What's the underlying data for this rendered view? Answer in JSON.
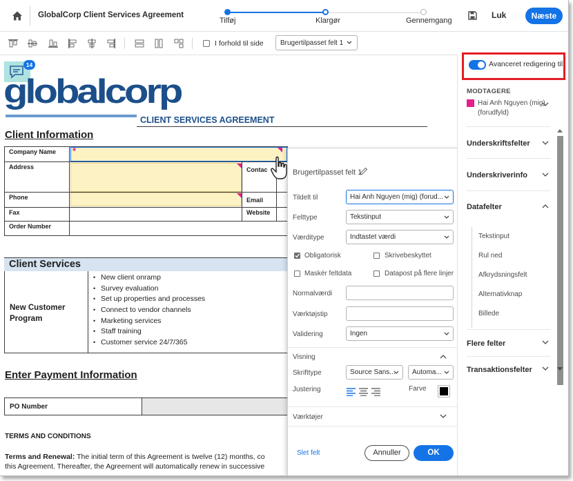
{
  "header": {
    "doc_title": "GlobalCorp Client Services Agreement",
    "steps": [
      "Tilføj",
      "Klargør",
      "Gennemgang"
    ],
    "close_label": "Luk",
    "next_label": "Næste"
  },
  "toolbar": {
    "proportional_label": "I forhold til side",
    "field_select": "Brugertilpasset felt 1"
  },
  "document": {
    "comment_count": "14",
    "logo_text": "globalcorp",
    "logo_sub": "CLIENT SERVICES AGREEMENT",
    "client_info_heading": "Client Information",
    "client_info_rows": {
      "company_name": "Company Name",
      "address": "Address",
      "contact": "Contac",
      "phone": "Phone",
      "email": "Email",
      "fax": "Fax",
      "website": "Website",
      "order_number": "Order Number"
    },
    "required_mark": "*",
    "client_services_heading": "Client Services",
    "program_label": "New Customer Program",
    "services": [
      "New client onramp",
      "Survey evaluation",
      "Set up properties and processes",
      "Connect to vendor channels",
      "Marketing services",
      "Staff training",
      "Customer service 24/7/365"
    ],
    "payment_heading": "Enter Payment Information",
    "po_label": "PO Number",
    "terms_heading": "TERMS AND CONDITIONS",
    "terms_bold": "Terms and Renewal:",
    "terms_line1": " The initial term of this Agreement is twelve (12) months, co",
    "terms_line2": "this Agreement. Thereafter, the Agreement will automatically renew in successive"
  },
  "popup": {
    "title": "Brugertilpasset felt 1",
    "assigned_label": "Tildelt til",
    "assigned_value": "Hai Anh Nguyen (mig) (forud...",
    "field_type_label": "Felttype",
    "field_type_value": "Tekstinput",
    "value_type_label": "Værditype",
    "value_type_value": "Indtastet værdi",
    "required_label": "Obligatorisk",
    "readonly_label": "Skrivebeskyttet",
    "mask_label": "Maskér feltdata",
    "multiline_label": "Datapost på flere linjer",
    "default_label": "Normalværdi",
    "tooltip_label": "Værktøjstip",
    "validation_label": "Validering",
    "validation_value": "Ingen",
    "display_label": "Visning",
    "font_label": "Skrifttype",
    "font_value": "Source Sans...",
    "size_value": "Automa...",
    "align_label": "Justering",
    "color_label": "Farve",
    "tools_label": "Værktøjer",
    "delete_link": "Slet felt",
    "cancel_label": "Annuller",
    "ok_label": "OK"
  },
  "rpanel": {
    "advanced_toggle": "Avanceret redigering til",
    "recipients_caps": "MODTAGERE",
    "recipient_name": "Hai Anh Nguyen (mig) (forudfyld)",
    "sections": [
      "Underskriftsfelter",
      "Underskriverinfo",
      "Datafelter"
    ],
    "data_fields": [
      "Tekstinput",
      "Rul ned",
      "Afkrydsningsfelt",
      "Alternativknap",
      "Billede"
    ],
    "more_fields": "Flere felter",
    "transaction_fields": "Transaktionsfelter"
  },
  "colors": {
    "accent": "#1473e6",
    "recipient": "#e61d8c",
    "highlight_border": "#e31e25",
    "field_fill": "#fdf2c3"
  }
}
